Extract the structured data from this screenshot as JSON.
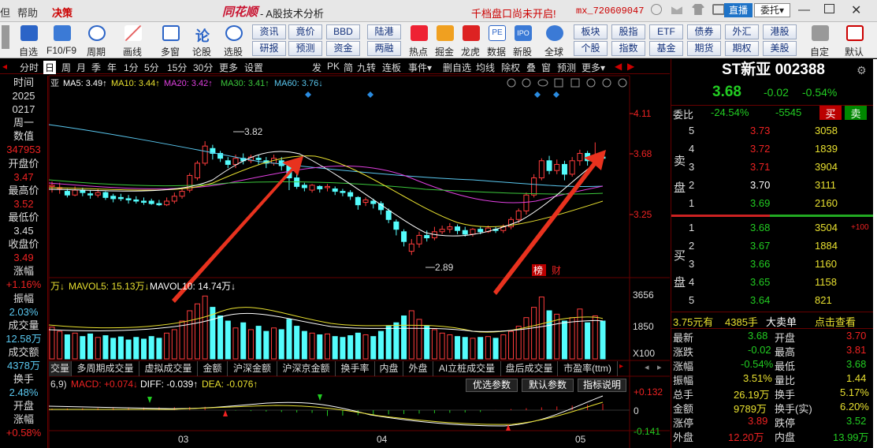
{
  "titlebar": {
    "menus": [
      "但",
      "帮助",
      "决策"
    ],
    "logo": "同花顺",
    "app_title": "A股技术分析",
    "notice": "千档盘口尚未开启!",
    "user": "mx_720609047",
    "live_btn": "直播",
    "delegate_btn": "委托"
  },
  "toolbar": {
    "main_tools": [
      "自选",
      "F10/F9",
      "周期",
      "画线",
      "多窗",
      "论股",
      "选股"
    ],
    "mid_row1": [
      "资讯",
      "竟价",
      "BBD",
      "陆港"
    ],
    "mid_row2": [
      "研报",
      "预测",
      "资金",
      "两融"
    ],
    "icon_tools": [
      "热点",
      "掘金",
      "龙虎",
      "数据",
      "新股",
      "全球"
    ],
    "right_row1": [
      "板块",
      "股指",
      "ETF",
      "债券",
      "外汇",
      "港股"
    ],
    "right_row2": [
      "个股",
      "指数",
      "基金",
      "期货",
      "期权",
      "美股"
    ],
    "end_tools": [
      "自定",
      "默认"
    ]
  },
  "periods": [
    "分时",
    "日",
    "周",
    "月",
    "季",
    "年",
    "1分",
    "5分",
    "15分",
    "30分",
    "更多",
    "设置"
  ],
  "chart_tabs": [
    "发",
    "PK",
    "简",
    "九转",
    "连板",
    "事件",
    "删自选",
    "均线",
    "除权",
    "叠",
    "窗",
    "预测",
    "更多"
  ],
  "ma": {
    "ma5": "MA5: 3.49↑",
    "ma10": "MA10: 3.44↑",
    "ma20": "MA20: 3.42↑",
    "ma30": "MA30: 3.41↑",
    "ma60": "MA60: 3.76↓"
  },
  "vol": {
    "unit": "万↓",
    "mavol5": "MAVOL5: 15.13万↓",
    "mavol10": "MAVOL10: 14.74万↓"
  },
  "macd": {
    "label": "6,9)",
    "macd": "MACD: +0.074↓",
    "diff": "DIFF: -0.039↑",
    "dea": "DEA: -0.076↑"
  },
  "price_axis": [
    "4.11",
    "3.68",
    "3.25"
  ],
  "vol_axis": [
    "3656",
    "1850",
    "X100"
  ],
  "macd_axis": [
    "+0.132",
    "0",
    "-0.141"
  ],
  "x_axis": [
    "03",
    "04",
    "05"
  ],
  "annotations": {
    "high": "3.82",
    "low": "2.89",
    "bang": "榜",
    "cai": "财"
  },
  "left_info": [
    {
      "label": "时间"
    },
    {
      "value": "2025"
    },
    {
      "value": "0217"
    },
    {
      "label": "周一"
    },
    {
      "label": "数值"
    },
    {
      "value": "347953"
    },
    {
      "label": "开盘价"
    },
    {
      "value": "3.47"
    },
    {
      "label": "最高价"
    },
    {
      "value": "3.52"
    },
    {
      "label": "最低价"
    },
    {
      "value": "3.45"
    },
    {
      "label": "收盘价"
    },
    {
      "value": "3.49"
    },
    {
      "label": "涨幅"
    },
    {
      "value": "+1.16%"
    },
    {
      "label": "振幅"
    },
    {
      "value": "2.03%"
    },
    {
      "label": "成交量"
    },
    {
      "value": "12.58万"
    },
    {
      "label": "成交额"
    },
    {
      "value": "4378万"
    },
    {
      "label": "换手"
    },
    {
      "value": "2.48%"
    },
    {
      "label": "开盘"
    },
    {
      "label": "涨幅"
    },
    {
      "value": "+0.58%"
    }
  ],
  "bottom_tabs": [
    "交量",
    "多周期成交量",
    "虚拟成交量",
    "金额",
    "沪深金额",
    "沪深京金额",
    "换手率",
    "内盘",
    "外盘",
    "AI立桩成交量",
    "盘后成交量",
    "市盈率(ttm)"
  ],
  "indicator_btns": [
    "优选参数",
    "默认参数",
    "指标说明"
  ],
  "stock": {
    "name": "ST新亚",
    "code": "002388",
    "price": "3.68",
    "change": "-0.02",
    "pct": "-0.54%"
  },
  "weibi": {
    "label": "委比",
    "ratio": "-24.54%",
    "diff": "-5545",
    "buy": "买",
    "sell": "卖"
  },
  "sell_label": "卖盘",
  "buy_label": "买盘",
  "asks": [
    {
      "n": "5",
      "p": "3.73",
      "v": "3058"
    },
    {
      "n": "4",
      "p": "3.72",
      "v": "1839"
    },
    {
      "n": "3",
      "p": "3.71",
      "v": "3904"
    },
    {
      "n": "2",
      "p": "3.70",
      "v": "3111"
    },
    {
      "n": "1",
      "p": "3.69",
      "v": "2160"
    }
  ],
  "bids": [
    {
      "n": "1",
      "p": "3.68",
      "v": "3504",
      "x": "+100"
    },
    {
      "n": "2",
      "p": "3.67",
      "v": "1884"
    },
    {
      "n": "3",
      "p": "3.66",
      "v": "1160"
    },
    {
      "n": "4",
      "p": "3.65",
      "v": "1158"
    },
    {
      "n": "5",
      "p": "3.64",
      "v": "821"
    }
  ],
  "big_order": {
    "price": "3.75元有",
    "qty": "4385手",
    "type": "大卖单",
    "link": "点击查看"
  },
  "quote": [
    {
      "l1": "最新",
      "v1": "3.68",
      "l2": "开盘",
      "v2": "3.70"
    },
    {
      "l1": "涨跌",
      "v1": "-0.02",
      "l2": "最高",
      "v2": "3.81"
    },
    {
      "l1": "涨幅",
      "v1": "-0.54%",
      "l2": "最低",
      "v2": "3.68"
    },
    {
      "l1": "振幅",
      "v1": "3.51%",
      "l2": "量比",
      "v2": "1.44"
    },
    {
      "l1": "总手",
      "v1": "26.19万",
      "l2": "换手",
      "v2": "5.17%"
    },
    {
      "l1": "金额",
      "v1": "9789万",
      "l2": "换手(实)",
      "v2": "6.20%"
    },
    {
      "l1": "涨停",
      "v1": "3.89",
      "l2": "跌停",
      "v2": "3.52"
    },
    {
      "l1": "外盘",
      "v1": "12.20万",
      "l2": "内盘",
      "v2": "13.99万"
    }
  ],
  "chart_data": {
    "type": "candlestick",
    "price_range": [
      2.75,
      4.2
    ],
    "candles": [
      [
        3.45,
        3.46,
        3.4,
        3.49
      ],
      [
        3.44,
        3.44,
        3.39,
        3.48
      ],
      [
        3.41,
        3.38,
        3.36,
        3.43
      ],
      [
        3.38,
        3.42,
        3.37,
        3.45
      ],
      [
        3.42,
        3.4,
        3.37,
        3.44
      ],
      [
        3.39,
        3.38,
        3.35,
        3.42
      ],
      [
        3.38,
        3.4,
        3.36,
        3.43
      ],
      [
        3.4,
        3.36,
        3.34,
        3.41
      ],
      [
        3.37,
        3.35,
        3.32,
        3.39
      ],
      [
        3.36,
        3.35,
        3.33,
        3.39
      ],
      [
        3.35,
        3.34,
        3.31,
        3.38
      ],
      [
        3.34,
        3.33,
        3.31,
        3.37
      ],
      [
        3.33,
        3.32,
        3.3,
        3.36
      ],
      [
        3.33,
        3.31,
        3.3,
        3.35
      ],
      [
        3.31,
        3.3,
        3.29,
        3.34
      ],
      [
        3.3,
        3.33,
        3.29,
        3.36
      ],
      [
        3.33,
        3.37,
        3.31,
        3.4
      ],
      [
        3.37,
        3.41,
        3.35,
        3.44
      ],
      [
        3.42,
        3.54,
        3.4,
        3.56
      ],
      [
        3.52,
        3.64,
        3.5,
        3.66
      ],
      [
        3.64,
        3.78,
        3.62,
        3.82
      ],
      [
        3.76,
        3.72,
        3.67,
        3.79
      ],
      [
        3.72,
        3.68,
        3.65,
        3.74
      ],
      [
        3.66,
        3.63,
        3.6,
        3.69
      ],
      [
        3.63,
        3.68,
        3.6,
        3.71
      ],
      [
        3.68,
        3.66,
        3.63,
        3.72
      ],
      [
        3.66,
        3.69,
        3.64,
        3.71
      ],
      [
        3.68,
        3.67,
        3.63,
        3.71
      ],
      [
        3.66,
        3.64,
        3.6,
        3.69
      ],
      [
        3.64,
        3.68,
        3.62,
        3.71
      ],
      [
        3.66,
        3.62,
        3.58,
        3.69
      ],
      [
        3.62,
        3.52,
        3.42,
        3.64
      ],
      [
        3.52,
        3.45,
        3.43,
        3.55
      ],
      [
        3.46,
        3.44,
        3.41,
        3.48
      ],
      [
        3.42,
        3.46,
        3.4,
        3.47
      ],
      [
        3.45,
        3.43,
        3.4,
        3.46
      ],
      [
        3.44,
        3.45,
        3.41,
        3.47
      ],
      [
        3.43,
        3.41,
        3.38,
        3.45
      ],
      [
        3.41,
        3.4,
        3.37,
        3.43
      ],
      [
        3.4,
        3.37,
        3.34,
        3.42
      ],
      [
        3.36,
        3.3,
        3.26,
        3.37
      ],
      [
        3.32,
        3.34,
        3.29,
        3.36
      ],
      [
        3.33,
        3.31,
        3.27,
        3.35
      ],
      [
        3.31,
        3.26,
        3.22,
        3.33
      ],
      [
        3.25,
        3.18,
        3.15,
        3.27
      ],
      [
        3.16,
        3.1,
        3.05,
        3.18
      ],
      [
        3.08,
        3.0,
        2.96,
        3.1
      ],
      [
        2.92,
        2.98,
        2.89,
        3.02
      ],
      [
        2.98,
        3.05,
        2.95,
        3.08
      ],
      [
        3.05,
        3.03,
        3.0,
        3.09
      ],
      [
        3.03,
        3.08,
        3.01,
        3.12
      ],
      [
        3.08,
        3.1,
        3.06,
        3.13
      ],
      [
        3.1,
        3.12,
        3.07,
        3.15
      ],
      [
        3.12,
        3.09,
        3.06,
        3.14
      ],
      [
        3.09,
        3.06,
        3.04,
        3.12
      ],
      [
        3.06,
        3.1,
        3.04,
        3.11
      ],
      [
        3.1,
        3.08,
        3.06,
        3.12
      ],
      [
        3.08,
        3.11,
        3.07,
        3.13
      ],
      [
        3.1,
        3.09,
        3.07,
        3.12
      ],
      [
        3.09,
        3.12,
        3.07,
        3.14
      ],
      [
        3.12,
        3.18,
        3.1,
        3.2
      ],
      [
        3.18,
        3.25,
        3.15,
        3.27
      ],
      [
        3.25,
        3.38,
        3.22,
        3.4
      ],
      [
        3.38,
        3.52,
        3.36,
        3.55
      ],
      [
        3.52,
        3.66,
        3.5,
        3.68
      ],
      [
        3.66,
        3.58,
        3.55,
        3.7
      ],
      [
        3.58,
        3.63,
        3.55,
        3.67
      ],
      [
        3.63,
        3.55,
        3.5,
        3.66
      ],
      [
        3.55,
        3.66,
        3.53,
        3.69
      ],
      [
        3.66,
        3.72,
        3.62,
        3.75
      ],
      [
        3.72,
        3.66,
        3.62,
        3.74
      ],
      [
        3.66,
        3.69,
        3.62,
        3.81
      ],
      [
        3.69,
        3.68,
        3.68,
        3.73
      ]
    ],
    "volume": [
      1850,
      1600,
      1400,
      1500,
      1300,
      1450,
      1250,
      1350,
      1200,
      1280,
      1100,
      1250,
      1150,
      1300,
      1200,
      1500,
      1700,
      2200,
      2800,
      3200,
      3656,
      3000,
      2500,
      2200,
      1800,
      2100,
      1700,
      1900,
      1600,
      1800,
      1700,
      2300,
      1900,
      1600,
      1500,
      1400,
      1450,
      1300,
      1250,
      1350,
      1500,
      1400,
      1300,
      1600,
      1900,
      2100,
      2500,
      2800,
      2300,
      1900,
      1700,
      1500,
      1400,
      1300,
      1250,
      1200,
      1250,
      1300,
      1200,
      1400,
      1600,
      1900,
      2400,
      3000,
      3600,
      2800,
      2600,
      2200,
      2400,
      2900,
      2100,
      2500,
      2200
    ],
    "volume_range": [
      0,
      3900
    ]
  }
}
